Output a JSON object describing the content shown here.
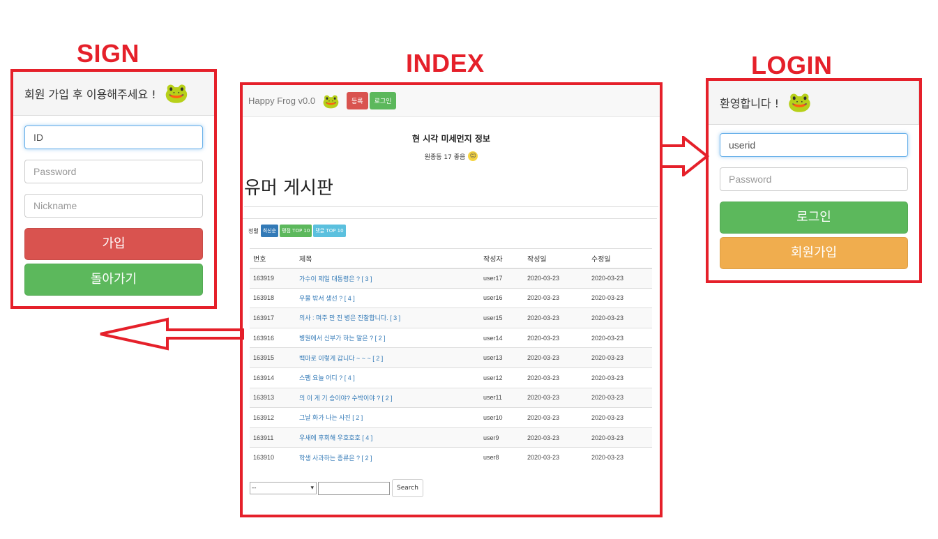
{
  "labels": {
    "sign": "SIGN",
    "index": "INDEX",
    "login": "LOGIN"
  },
  "colors": {
    "accent_red": "#e5202a",
    "btn_red": "#d9534f",
    "btn_green": "#5cb85c",
    "btn_orange": "#f0ad4e",
    "link_blue": "#337ab7"
  },
  "icons": {
    "frog": "frog-icon",
    "smiley": "smiley-icon",
    "arrow_left": "arrow-left-icon",
    "arrow_right": "arrow-right-icon"
  },
  "sign": {
    "heading": "회원 가입 후 이용해주세요 !",
    "id_placeholder": "ID",
    "password_placeholder": "Password",
    "nickname_placeholder": "Nickname",
    "join_button": "가입",
    "back_button": "돌아가기"
  },
  "login": {
    "heading": "환영합니다 !",
    "userid_placeholder": "userid",
    "password_placeholder": "Password",
    "login_button": "로그인",
    "signup_button": "회원가입"
  },
  "index": {
    "brand": "Happy Frog v0.0",
    "nav_register": "등록",
    "nav_login": "로그인",
    "dust_title": "현 시각 미세먼지 정보",
    "dust_info": "원종동 17 좋음",
    "board_title": "유머 게시판",
    "sort_label": "정렬",
    "sort_latest": "최신순",
    "sort_likes": "평점 TOP 10",
    "sort_comments": "댓글 TOP 10",
    "columns": [
      "번호",
      "제목",
      "작성자",
      "작성일",
      "수정일"
    ],
    "rows": [
      [
        "163919",
        "가수이 제일 대통령은 ? [ 3 ]",
        "user17",
        "2020-03-23",
        "2020-03-23"
      ],
      [
        "163918",
        "우물 밖서 생선 ? [ 4 ]",
        "user16",
        "2020-03-23",
        "2020-03-23"
      ],
      [
        "163917",
        "의사 : 며주 만 진 병은 진찰합니다. [ 3 ]",
        "user15",
        "2020-03-23",
        "2020-03-23"
      ],
      [
        "163916",
        "병원에서 신부가 하는 말은 ? [ 2 ]",
        "user14",
        "2020-03-23",
        "2020-03-23"
      ],
      [
        "163915",
        "백마로 이렇게 갑니다 ~ ~ ~ [ 2 ]",
        "user13",
        "2020-03-23",
        "2020-03-23"
      ],
      [
        "163914",
        "스팸 요늘 어디 ? [ 4 ]",
        "user12",
        "2020-03-23",
        "2020-03-23"
      ],
      [
        "163913",
        "의 이 게 기 승이야? 수박이야 ? [ 2 ]",
        "user11",
        "2020-03-23",
        "2020-03-23"
      ],
      [
        "163912",
        "그날 화가 나는 사진 [ 2 ]",
        "user10",
        "2020-03-23",
        "2020-03-23"
      ],
      [
        "163911",
        "우새에 후회해 우호호호 [ 4 ]",
        "user9",
        "2020-03-23",
        "2020-03-23"
      ],
      [
        "163910",
        "학생 사과하는 종류은 ? [ 2 ]",
        "user8",
        "2020-03-23",
        "2020-03-23"
      ]
    ],
    "search_select_value": "--",
    "search_button": "Search"
  }
}
